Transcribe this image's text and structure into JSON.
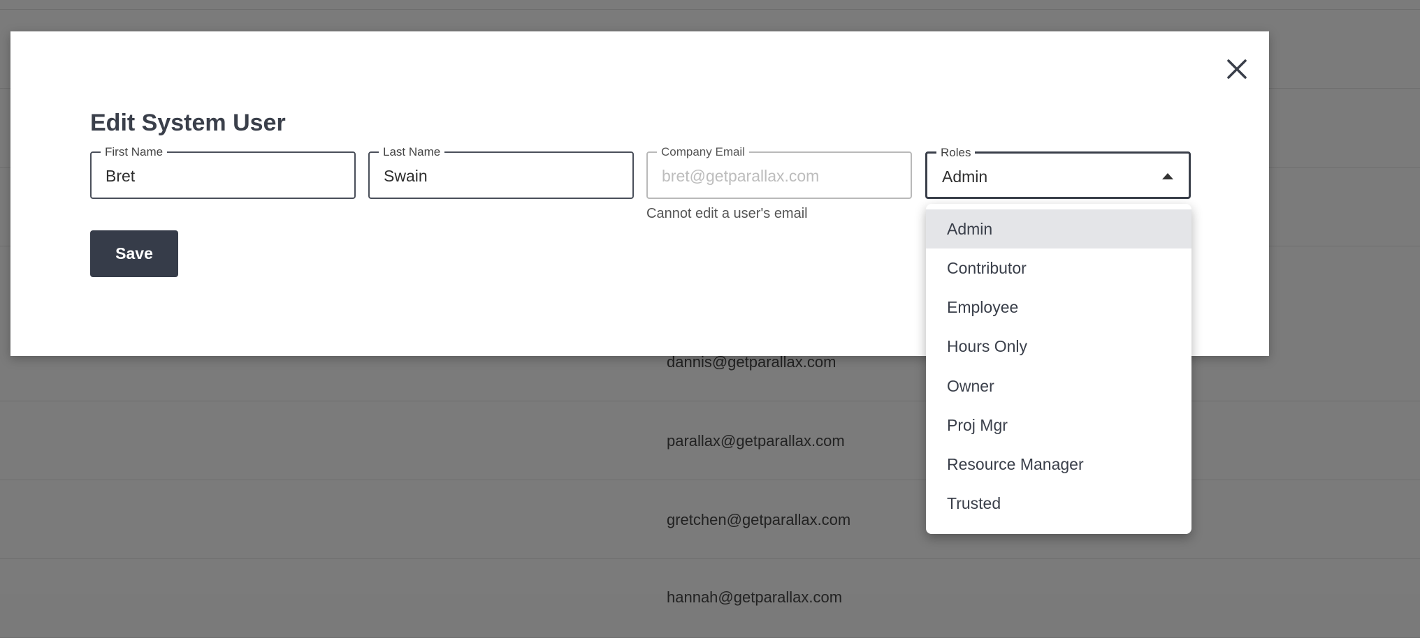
{
  "background": {
    "emails": [
      "dannis@getparallax.com",
      "parallax@getparallax.com",
      "gretchen@getparallax.com",
      "hannah@getparallax.com"
    ]
  },
  "modal": {
    "title": "Edit System User",
    "close_icon": "close-icon",
    "fields": {
      "first_name": {
        "label": "First Name",
        "value": "Bret"
      },
      "last_name": {
        "label": "Last Name",
        "value": "Swain"
      },
      "company_email": {
        "label": "Company Email",
        "placeholder": "bret@getparallax.com",
        "helper": "Cannot edit a user's email"
      },
      "roles": {
        "label": "Roles",
        "value": "Admin"
      }
    },
    "save_label": "Save"
  },
  "roles_dropdown": {
    "selected": "Admin",
    "options": [
      "Admin",
      "Contributor",
      "Employee",
      "Hours Only",
      "Owner",
      "Proj Mgr",
      "Resource Manager",
      "Trusted"
    ]
  },
  "colors": {
    "primary_button": "#363c49",
    "overlay": "#7b7b7b",
    "selected_option": "#e4e5e8"
  }
}
